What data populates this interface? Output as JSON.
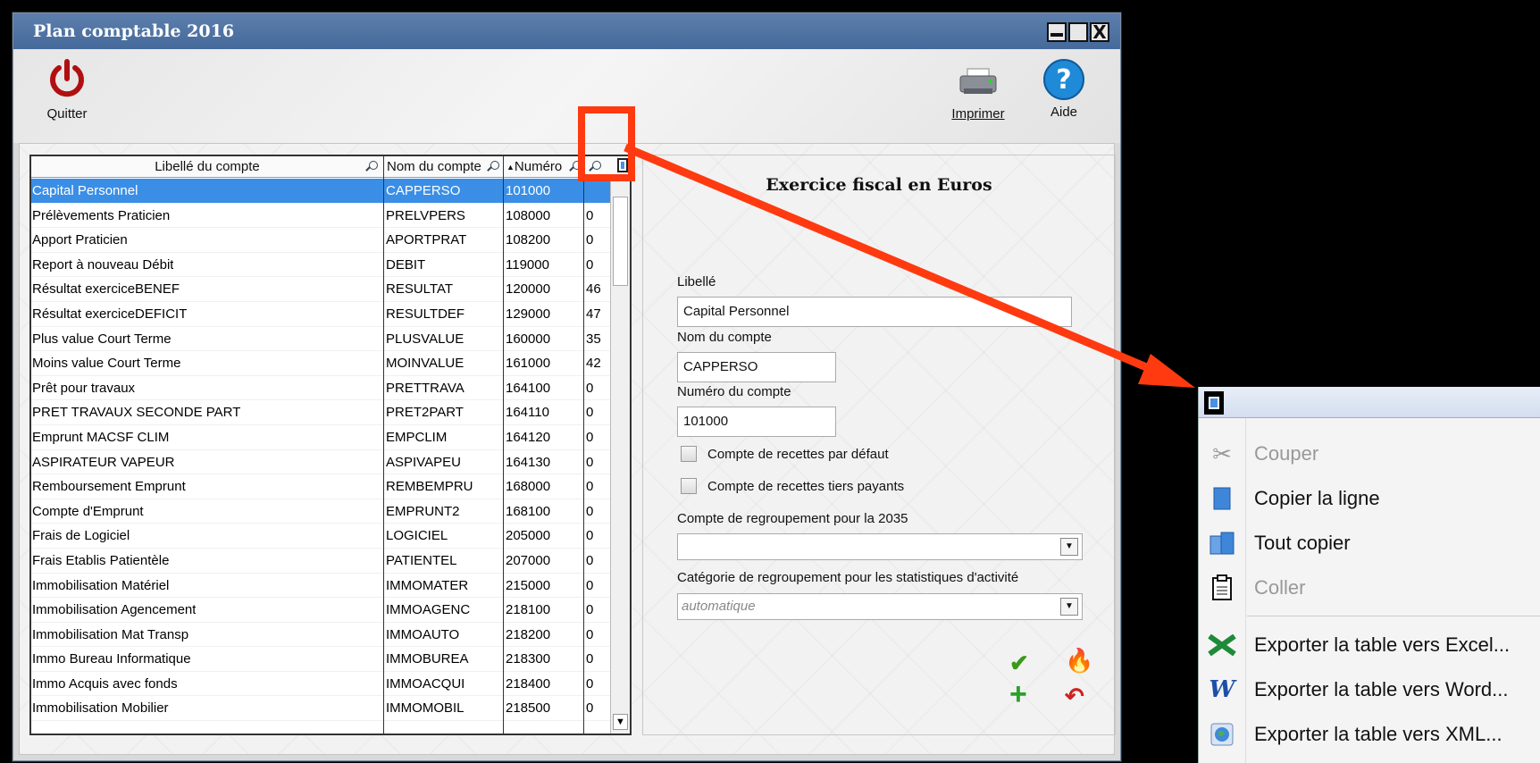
{
  "window": {
    "title": "Plan comptable 2016",
    "close_glyph": "X"
  },
  "toolbar": {
    "quit_label": "Quitter",
    "print_label": "Imprimer",
    "help_label": "Aide"
  },
  "table": {
    "columns": [
      "Libellé du compte",
      "Nom du compte",
      "Numéro",
      ""
    ],
    "rows": [
      [
        "Capital Personnel",
        "CAPPERSO",
        "101000",
        ""
      ],
      [
        "Prélèvements Praticien",
        "PRELVPERS",
        "108000",
        "0"
      ],
      [
        "Apport Praticien",
        "APORTPRAT",
        "108200",
        "0"
      ],
      [
        "Report à nouveau Débit",
        "DEBIT",
        "119000",
        "0"
      ],
      [
        "Résultat exerciceBENEF",
        "RESULTAT",
        "120000",
        "46"
      ],
      [
        "Résultat exerciceDEFICIT",
        "RESULTDEF",
        "129000",
        "47"
      ],
      [
        "Plus value Court Terme",
        "PLUSVALUE",
        "160000",
        "35"
      ],
      [
        "Moins value Court Terme",
        "MOINVALUE",
        "161000",
        "42"
      ],
      [
        "Prêt pour travaux",
        "PRETTRAVA",
        "164100",
        "0"
      ],
      [
        "PRET TRAVAUX SECONDE PART",
        "PRET2PART",
        "164110",
        "0"
      ],
      [
        "Emprunt MACSF CLIM",
        "EMPCLIM",
        "164120",
        "0"
      ],
      [
        "ASPIRATEUR VAPEUR",
        "ASPIVAPEU",
        "164130",
        "0"
      ],
      [
        "Remboursement Emprunt",
        "REMBEMPRU",
        "168000",
        "0"
      ],
      [
        "Compte d'Emprunt",
        "EMPRUNT2",
        "168100",
        "0"
      ],
      [
        "Frais de Logiciel",
        "LOGICIEL",
        "205000",
        "0"
      ],
      [
        "Frais Etablis Patientèle",
        "PATIENTEL",
        "207000",
        "0"
      ],
      [
        "Immobilisation Matériel",
        "IMMOMATER",
        "215000",
        "0"
      ],
      [
        "Immobilisation Agencement",
        "IMMOAGENC",
        "218100",
        "0"
      ],
      [
        "Immobilisation Mat Transp",
        "IMMOAUTO",
        "218200",
        "0"
      ],
      [
        "Immo Bureau Informatique",
        "IMMOBUREA",
        "218300",
        "0"
      ],
      [
        "Immo Acquis avec fonds",
        "IMMOACQUI",
        "218400",
        "0"
      ],
      [
        "Immobilisation Mobilier",
        "IMMOMOBIL",
        "218500",
        "0"
      ]
    ]
  },
  "panel": {
    "title": "Exercice fiscal en Euros",
    "libelle_label": "Libellé",
    "libelle_value": "Capital Personnel",
    "nom_label": "Nom du compte",
    "nom_value": "CAPPERSO",
    "numero_label": "Numéro du compte",
    "numero_value": "101000",
    "check1_label": "Compte de recettes par défaut",
    "check2_label": "Compte de recettes tiers payants",
    "regroup_label": "Compte de regroupement pour la 2035",
    "regroup_value": "",
    "categorie_label": "Catégorie de regroupement pour les statistiques d'activité",
    "categorie_value": "automatique"
  },
  "context_menu": {
    "items": [
      {
        "label": "Couper",
        "icon": "scissors-icon",
        "disabled": true
      },
      {
        "label": "Copier la ligne",
        "icon": "copy-line-icon",
        "disabled": false
      },
      {
        "label": "Tout copier",
        "icon": "copy-all-icon",
        "disabled": false
      },
      {
        "label": "Coller",
        "icon": "paste-icon",
        "disabled": true
      },
      {
        "label": "Exporter la table vers Excel...",
        "icon": "excel-icon",
        "disabled": false
      },
      {
        "label": "Exporter la table vers Word...",
        "icon": "word-icon",
        "disabled": false
      },
      {
        "label": "Exporter la table vers XML...",
        "icon": "xml-globe-icon",
        "disabled": false
      }
    ]
  },
  "colors": {
    "selection": "#3a8ee6",
    "titlebar": "#4f74a4",
    "annotation": "#ff3a10"
  }
}
